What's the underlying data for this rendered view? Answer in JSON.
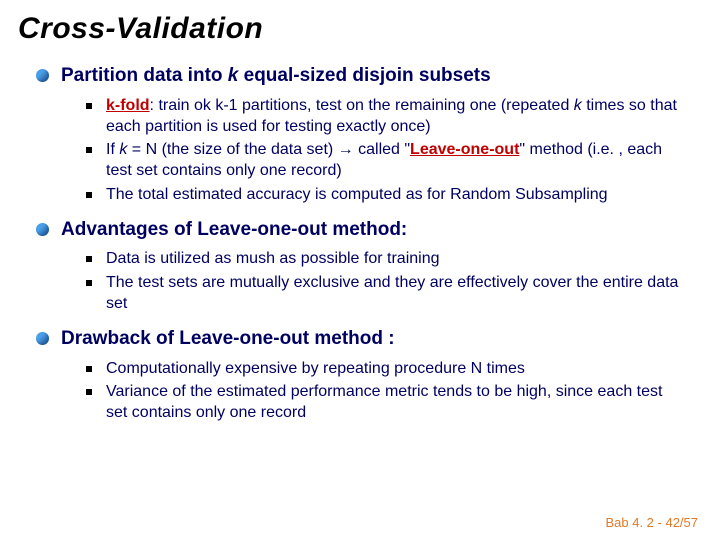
{
  "title": "Cross-Validation",
  "sections": [
    {
      "heading_parts": [
        {
          "text": "Partition data into ",
          "italic": false
        },
        {
          "text": "k",
          "italic": true
        },
        {
          "text": " equal-sized disjoin subsets",
          "italic": false
        }
      ],
      "items": [
        {
          "runs": [
            {
              "text": "k-fold",
              "hl": true,
              "u": true
            },
            {
              "text": ": train ok k-1 partitions, test on the remaining one (repeated "
            },
            {
              "text": "k",
              "italic": true
            },
            {
              "text": " times so that each partition is used for testing exactly once)"
            }
          ]
        },
        {
          "runs": [
            {
              "text": "If "
            },
            {
              "text": "k",
              "italic": true
            },
            {
              "text": " = N (the size of the data set) → called \""
            },
            {
              "text": "Leave-one-out",
              "hl": true,
              "u": true
            },
            {
              "text": "\" method (i.e. , each test set contains only one record)"
            }
          ]
        },
        {
          "runs": [
            {
              "text": "The total estimated accuracy is computed as for Random Subsampling"
            }
          ]
        }
      ]
    },
    {
      "heading_parts": [
        {
          "text": "Advantages of Leave-one-out method:"
        }
      ],
      "items": [
        {
          "runs": [
            {
              "text": "Data is utilized as mush as possible for training"
            }
          ]
        },
        {
          "runs": [
            {
              "text": "The test sets are mutually exclusive and they are effectively cover the entire data set"
            }
          ]
        }
      ]
    },
    {
      "heading_parts": [
        {
          "text": "Drawback of Leave-one-out method :"
        }
      ],
      "items": [
        {
          "runs": [
            {
              "text": "Computationally expensive by repeating procedure N times"
            }
          ]
        },
        {
          "runs": [
            {
              "text": "Variance of the estimated performance metric tends to be high, since each test set contains only one record"
            }
          ]
        }
      ]
    }
  ],
  "footer": "Bab 4. 2 - 42/57"
}
